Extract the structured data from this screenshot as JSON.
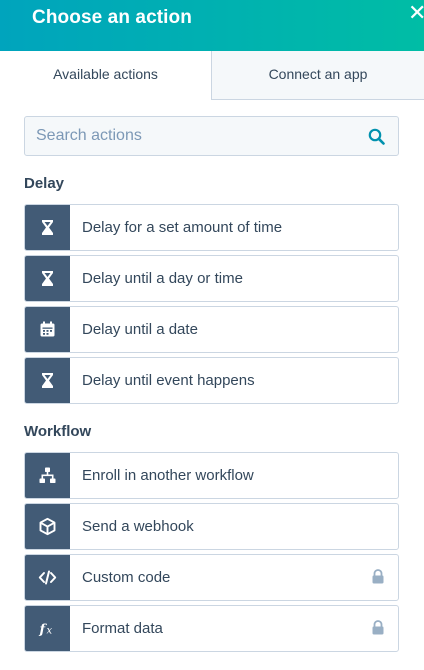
{
  "panel": {
    "title": "Choose an action",
    "close_icon": "close-icon"
  },
  "tabs": [
    {
      "label": "Available actions",
      "active": true
    },
    {
      "label": "Connect an app",
      "active": false
    }
  ],
  "search": {
    "placeholder": "Search actions",
    "icon": "search-icon"
  },
  "sections": [
    {
      "label": "Delay",
      "items": [
        {
          "label": "Delay for a set amount of time",
          "icon": "hourglass-icon",
          "locked": false
        },
        {
          "label": "Delay until a day or time",
          "icon": "hourglass-icon",
          "locked": false
        },
        {
          "label": "Delay until a date",
          "icon": "calendar-icon",
          "locked": false
        },
        {
          "label": "Delay until event happens",
          "icon": "hourglass-icon",
          "locked": false
        }
      ]
    },
    {
      "label": "Workflow",
      "items": [
        {
          "label": "Enroll in another workflow",
          "icon": "workflow-branch-icon",
          "locked": false
        },
        {
          "label": "Send a webhook",
          "icon": "cube-icon",
          "locked": false
        },
        {
          "label": "Custom code",
          "icon": "code-icon",
          "locked": true
        },
        {
          "label": "Format data",
          "icon": "function-icon",
          "locked": true
        }
      ]
    }
  ],
  "colors": {
    "header_gradient_start": "#00a4bd",
    "header_gradient_end": "#00bda5",
    "icon_tile": "#425b76",
    "text": "#33475b",
    "border": "#cbd6e2",
    "accent": "#0091ae"
  }
}
